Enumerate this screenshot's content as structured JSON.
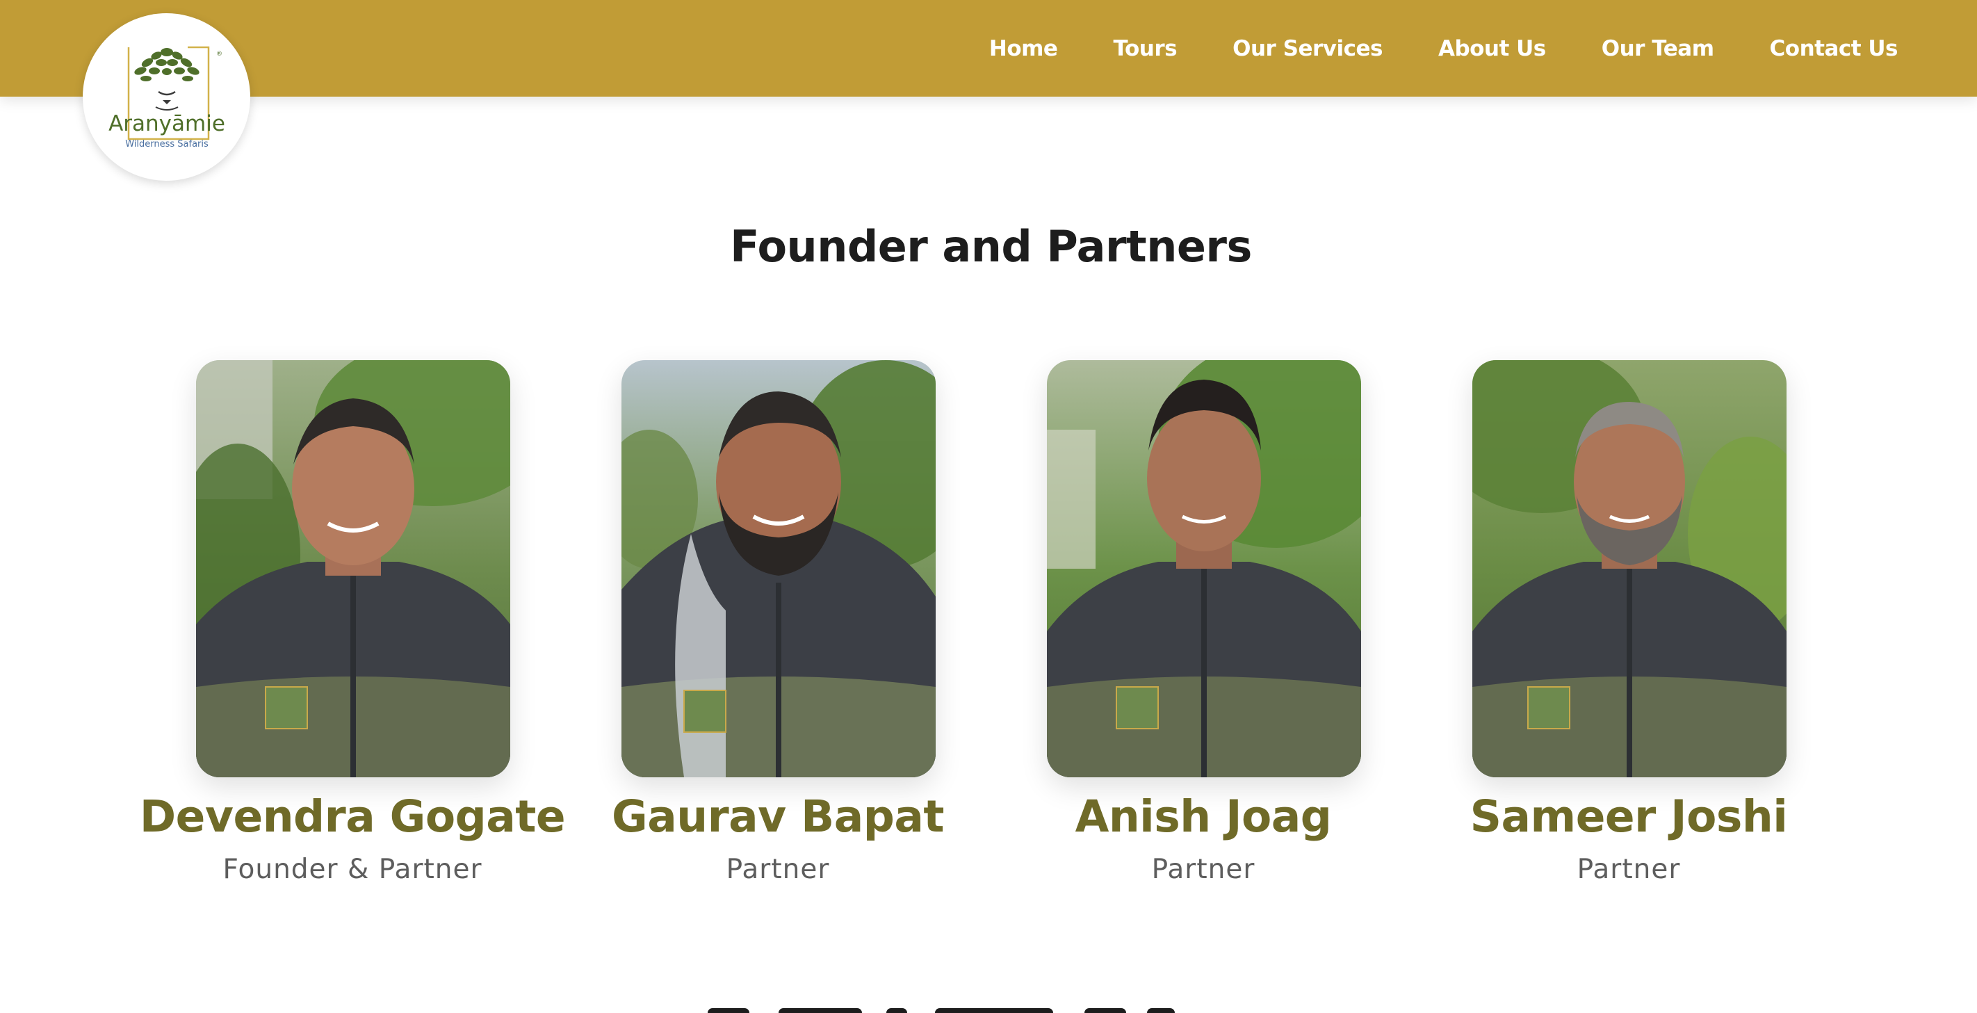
{
  "brand": {
    "name": "Aranyāmie",
    "tagline": "Wilderness Safaris",
    "registered_mark": "®"
  },
  "nav": {
    "items": [
      {
        "label": "Home"
      },
      {
        "label": "Tours"
      },
      {
        "label": "Our Services"
      },
      {
        "label": "About Us"
      },
      {
        "label": "Our Team"
      },
      {
        "label": "Contact Us"
      }
    ]
  },
  "section": {
    "title": "Founder and Partners"
  },
  "team": [
    {
      "name": "Devendra Gogate",
      "role": "Founder & Partner"
    },
    {
      "name": "Gaurav Bapat",
      "role": "Partner"
    },
    {
      "name": "Anish Joag",
      "role": "Partner"
    },
    {
      "name": "Sameer Joshi",
      "role": "Partner"
    }
  ],
  "colors": {
    "header": "#c19c36",
    "name_olive": "#6f6a28",
    "brand_green": "#4f6f2a"
  }
}
